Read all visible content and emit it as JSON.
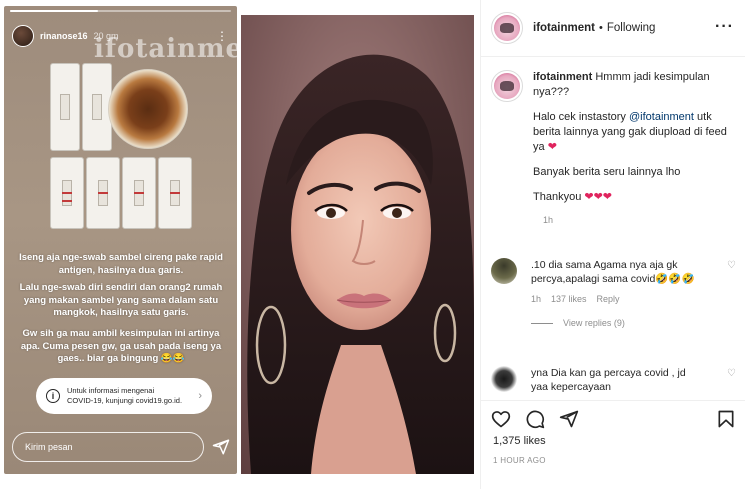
{
  "story": {
    "username": "rinanose16",
    "time": "20 gm",
    "watermark": "ifotainment",
    "text1": "Iseng aja nge-swab sambel cireng pake rapid antigen, hasilnya dua garis.",
    "text2": "Lalu nge-swab diri sendiri dan orang2 rumah yang makan sambel yang sama dalam satu mangkok, hasilnya satu garis.",
    "text3": "Gw sih ga mau ambil kesimpulan ini artinya apa. Cuma pesen gw, ga usah pada iseng ya gaes.. biar ga bingung 😂😂",
    "covid_line1": "Untuk informasi mengenai",
    "covid_line2": "COVID-19, kunjungi covid19.go.id.",
    "reply_placeholder": "Kirim pesan"
  },
  "post": {
    "username": "ifotainment",
    "separator": "•",
    "follow_state": "Following",
    "more": "···"
  },
  "caption": {
    "username": "ifotainment",
    "line1": "Hmmm jadi kesimpulan nya???",
    "p2_before": "Halo cek instastory ",
    "p2_link": "@ifotainment",
    "p2_after": " utk berita lainnya yang gak diupload di feed ya ",
    "p3": "Banyak berita seru lainnya lho",
    "p4": "Thankyou ",
    "hearts_one": "❤",
    "hearts_three": "❤❤❤",
    "time": "1h"
  },
  "comments": [
    {
      "username": "",
      "text": ".10 dia sama Agama nya aja gk percya,apalagi sama covid🤣🤣🤣",
      "time": "1h",
      "likes": "137 likes",
      "reply": "Reply",
      "view_replies": "View replies (9)"
    },
    {
      "username": "",
      "text": "yna Dia kan ga percaya covid , jd yaa kepercayaan"
    }
  ],
  "actions": {
    "likes": "1,375 likes",
    "posted": "1 HOUR AGO"
  },
  "colors": {
    "link": "#00376b",
    "heart": "#e0245e",
    "muted": "#8e8e8e",
    "story_bg": "#a89684"
  }
}
